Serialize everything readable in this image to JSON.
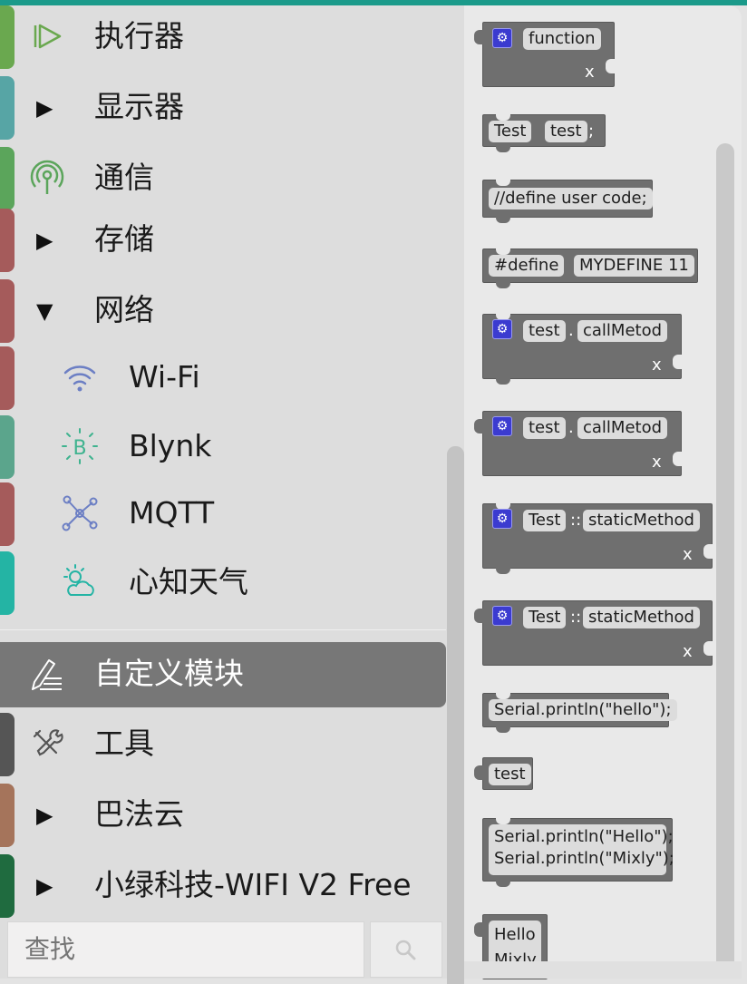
{
  "categories": [
    {
      "label": "执行器",
      "icon": "play-outline-icon",
      "color": "#6aa84f"
    },
    {
      "label": "显示器",
      "icon": "triangle-right-icon",
      "color": "#57a5a5"
    },
    {
      "label": "通信",
      "icon": "antenna-icon",
      "color": "#5ba55b"
    },
    {
      "label": "存储",
      "icon": "triangle-right-icon",
      "color": "#a55b5b"
    },
    {
      "label": "网络",
      "icon": "triangle-down-icon",
      "color": "#a55b5b"
    },
    {
      "label": "Wi-Fi",
      "icon": "wifi-icon",
      "color": "#a55b5b"
    },
    {
      "label": "Blynk",
      "icon": "blynk-icon",
      "color": "#5ba58c"
    },
    {
      "label": "MQTT",
      "icon": "network-icon",
      "color": "#a55b5b"
    },
    {
      "label": "心知天气",
      "icon": "weather-icon",
      "color": "#24b4a4"
    },
    {
      "label": "自定义模块",
      "icon": "pencil-list-icon",
      "color": "#777777"
    },
    {
      "label": "工具",
      "icon": "tools-icon",
      "color": "#555555"
    },
    {
      "label": "巴法云",
      "icon": "triangle-right-icon",
      "color": "#a5745b"
    },
    {
      "label": "小绿科技-WIFI V2 Free",
      "icon": "triangle-right-icon",
      "color": "#1f6b3f"
    }
  ],
  "search": {
    "placeholder": "查找",
    "button_icon": "search-icon"
  },
  "blocks": {
    "b1": {
      "name": "function",
      "arg": "x"
    },
    "b2": {
      "type": "Test",
      "var": "test",
      "semicolon": ";"
    },
    "b3": {
      "code": "//define user code;"
    },
    "b4": {
      "keyword": "#define",
      "value": "MYDEFINE 11"
    },
    "b5": {
      "obj": "test",
      "dot": ".",
      "method": "callMetod",
      "arg": "x"
    },
    "b6": {
      "obj": "test",
      "dot": ".",
      "method": "callMetod",
      "arg": "x"
    },
    "b7": {
      "cls": "Test",
      "sep": "::",
      "method": "staticMethod",
      "arg": "x"
    },
    "b8": {
      "cls": "Test",
      "sep": "::",
      "method": "staticMethod",
      "arg": "x"
    },
    "b9": {
      "code": "Serial.println(\"hello\");"
    },
    "b10": {
      "value": "test"
    },
    "b11": {
      "line1": "Serial.println(\"Hello\");",
      "line2": "Serial.println(\"Mixly\");"
    },
    "b12": {
      "line1": "Hello",
      "line2": "Mixly"
    }
  },
  "colors": {
    "accent": "#1b9a8a",
    "block": "#6f6f6f",
    "gear": "#3b3bd0",
    "selected": "#777777"
  }
}
